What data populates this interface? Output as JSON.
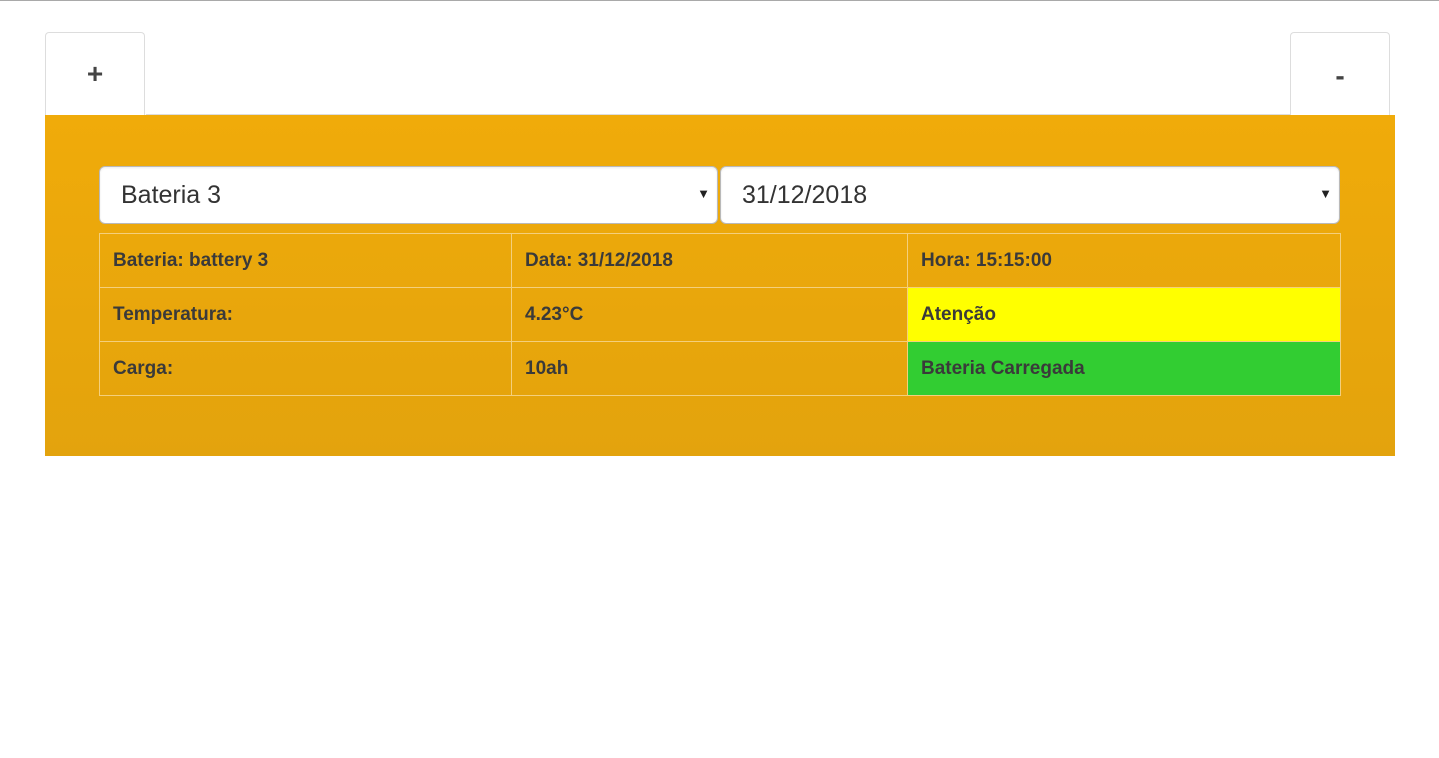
{
  "tabs": {
    "add_label": "+",
    "remove_label": "-"
  },
  "selectors": {
    "battery": {
      "selected": "Bateria 3"
    },
    "date": {
      "selected": "31/12/2018"
    }
  },
  "info_table": {
    "rows": [
      [
        "Bateria: battery 3",
        "Data: 31/12/2018",
        "Hora: 15:15:00"
      ],
      [
        "Temperatura:",
        "4.23°C",
        "Atenção"
      ],
      [
        "Carga:",
        "10ah",
        "Bateria Carregada"
      ]
    ]
  },
  "colors": {
    "panel": "#f0ab0a",
    "warning_status": "#ffff00",
    "ok_status": "#32cd32"
  }
}
